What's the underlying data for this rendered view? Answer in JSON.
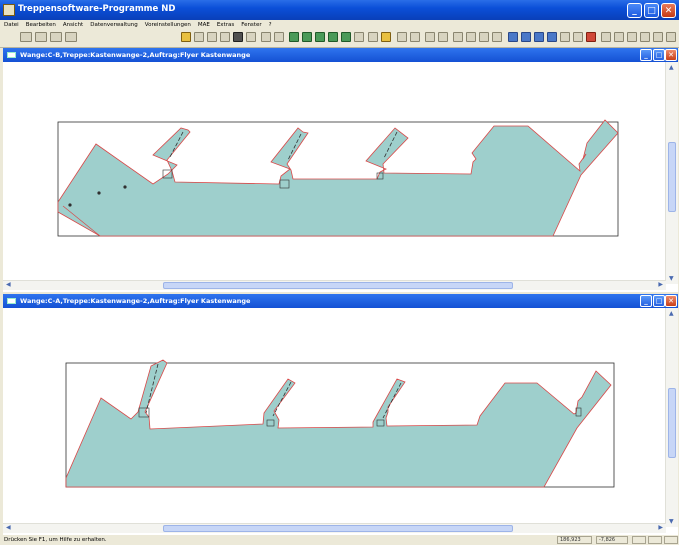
{
  "app": {
    "title": "Treppensoftware-Programme ND",
    "minimize": "_",
    "maximize": "□",
    "close": "✕"
  },
  "menu": [
    "Datei",
    "Bearbeiten",
    "Ansicht",
    "Datenverwaltung",
    "Voreinstellungen",
    "MAE",
    "Extras",
    "Fenster",
    "?"
  ],
  "windows": [
    {
      "title": "Wange:C-B,Treppe:Kastenwange-2,Auftrag:Flyer Kastenwange"
    },
    {
      "title": "Wange:C-A,Treppe:Kastenwange-2,Auftrag:Flyer Kastenwange"
    }
  ],
  "colors": {
    "fill": "#9ecfcc",
    "outline": "#d84848",
    "frame": "#303030"
  },
  "status": {
    "message": "Drücken Sie F1, um Hilfe zu erhalten.",
    "x": "186,923",
    "y": "-7,826"
  }
}
